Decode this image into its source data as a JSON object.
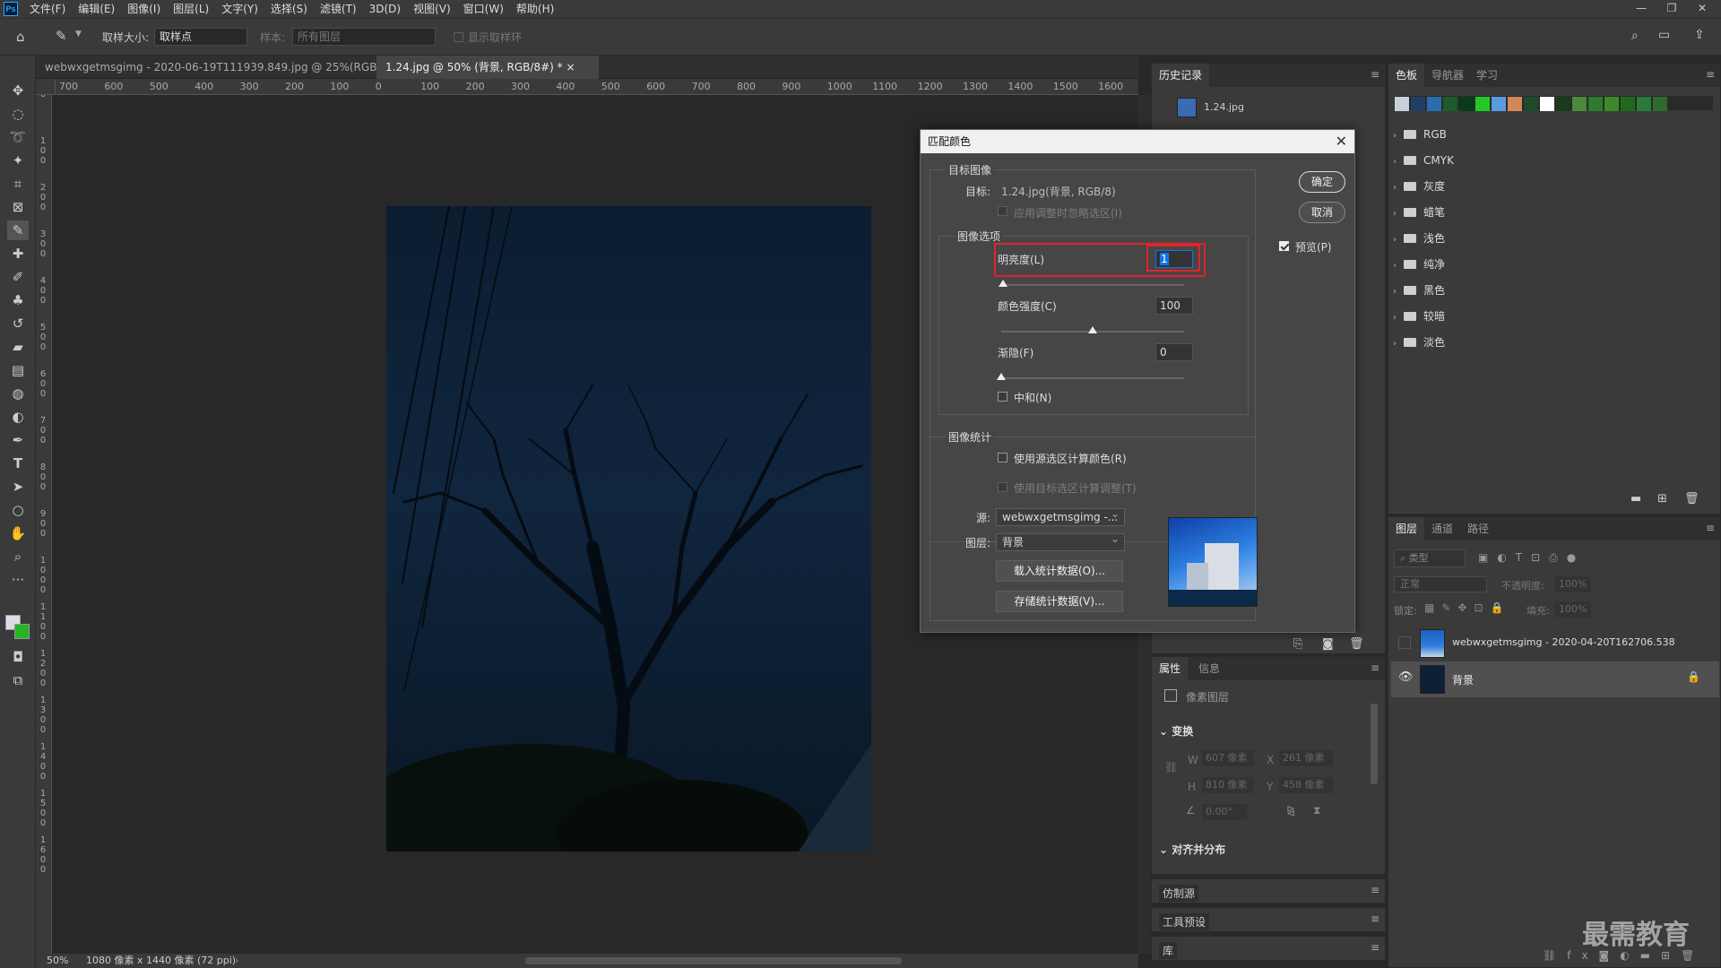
{
  "app": {
    "logo": "Ps"
  },
  "menu": [
    "文件(F)",
    "编辑(E)",
    "图像(I)",
    "图层(L)",
    "文字(Y)",
    "选择(S)",
    "滤镜(T)",
    "3D(D)",
    "视图(V)",
    "窗口(W)",
    "帮助(H)"
  ],
  "options": {
    "sample_size_label": "取样大小:",
    "sample_size_value": "取样点",
    "sample_label": "样本:",
    "sample_value": "所有图层",
    "show_ring": "显示取样环"
  },
  "tabs": [
    "webwxgetmsgimg - 2020-06-19T111939.849.jpg @ 25%(RGB/8) *",
    "1.24.jpg @ 50% (背景, RGB/8#) *"
  ],
  "ruler_h": [
    "700",
    "600",
    "500",
    "400",
    "300",
    "200",
    "100",
    "0",
    "100",
    "200",
    "300",
    "400",
    "500",
    "600",
    "700",
    "800",
    "900",
    "1000",
    "1100",
    "1200",
    "1300",
    "1400",
    "1500",
    "1600"
  ],
  "ruler_v": [
    "0",
    "1\n0\n0",
    "2\n0\n0",
    "3\n0\n0",
    "4\n0\n0",
    "5\n0\n0",
    "6\n0\n0",
    "7\n0\n0",
    "8\n0\n0",
    "9\n0\n0",
    "1\n0\n0\n0",
    "1\n1\n0\n0",
    "1\n2\n0\n0",
    "1\n3\n0\n0",
    "1\n4\n0\n0",
    "1\n5\n0\n0",
    "1\n6\n0\n0"
  ],
  "status": {
    "zoom": "50%",
    "info": "1080 像素 x 1440 像素 (72 ppi)"
  },
  "history": {
    "tab": "历史记录",
    "item": "1.24.jpg"
  },
  "swatches": {
    "tabs": [
      "色板",
      "导航器",
      "学习"
    ],
    "colors": [
      "#c8d0dc",
      "#1f3f66",
      "#2a6cb0",
      "#1b5c2a",
      "#0a3a18",
      "#24c824",
      "#5a9ae0",
      "#d4865a",
      "#1e4a2a",
      "#ffffff",
      "#1a3a1a",
      "#4a8a3a",
      "#2e7a2e",
      "#3a8a2a",
      "#1e6a1e",
      "#2a7a3a",
      "#2e6a2e"
    ],
    "folders": [
      "RGB",
      "CMYK",
      "灰度",
      "蜡笔",
      "浅色",
      "纯净",
      "黑色",
      "较暗",
      "淡色"
    ]
  },
  "properties": {
    "tabs": [
      "属性",
      "信息"
    ],
    "pixel_layer": "像素图层",
    "transform": "变换",
    "w_label": "W",
    "w_value": "607 像素",
    "x_label": "X",
    "x_value": "261 像素",
    "h_label": "H",
    "h_value": "810 像素",
    "y_label": "Y",
    "y_value": "458 像素",
    "angle": "0.00°",
    "align": "对齐并分布"
  },
  "small_panels": [
    "仿制源",
    "工具预设",
    "库"
  ],
  "layers": {
    "tabs": [
      "图层",
      "通道",
      "路径"
    ],
    "filter": "类型",
    "blend": "正常",
    "opacity_label": "不透明度:",
    "opacity": "100%",
    "lock_label": "锁定:",
    "fill_label": "填充:",
    "fill": "100%",
    "items": [
      {
        "name": "webwxgetmsgimg - 2020-04-20T162706.538"
      },
      {
        "name": "背景"
      }
    ]
  },
  "watermark": "最需教育",
  "dialog": {
    "title": "匹配颜色",
    "target_group": "目标图像",
    "target_label": "目标:",
    "target_value": "1.24.jpg(背景, RGB/8)",
    "ignore_selection": "应用调整时忽略选区(I)",
    "options_group": "图像选项",
    "luminance_label": "明亮度(L)",
    "luminance": "1",
    "luminance_ratio": 0.01,
    "intensity_label": "颜色强度(C)",
    "intensity": "100",
    "intensity_ratio": 0.5,
    "fade_label": "渐隐(F)",
    "fade": "0",
    "fade_ratio": 0,
    "neutralize": "中和(N)",
    "stats_group": "图像统计",
    "use_source_sel": "使用源选区计算颜色(R)",
    "use_target_sel": "使用目标选区计算调整(T)",
    "source_label": "源:",
    "source_value": "webwxgetmsgimg -...",
    "layer_label": "图层:",
    "layer_value": "背景",
    "load_stats": "载入统计数据(O)...",
    "save_stats": "存储统计数据(V)...",
    "ok": "确定",
    "cancel": "取消",
    "preview": "预览(P)"
  },
  "colors": {
    "highlight": "#e0242b",
    "accent": "#1473e6"
  }
}
